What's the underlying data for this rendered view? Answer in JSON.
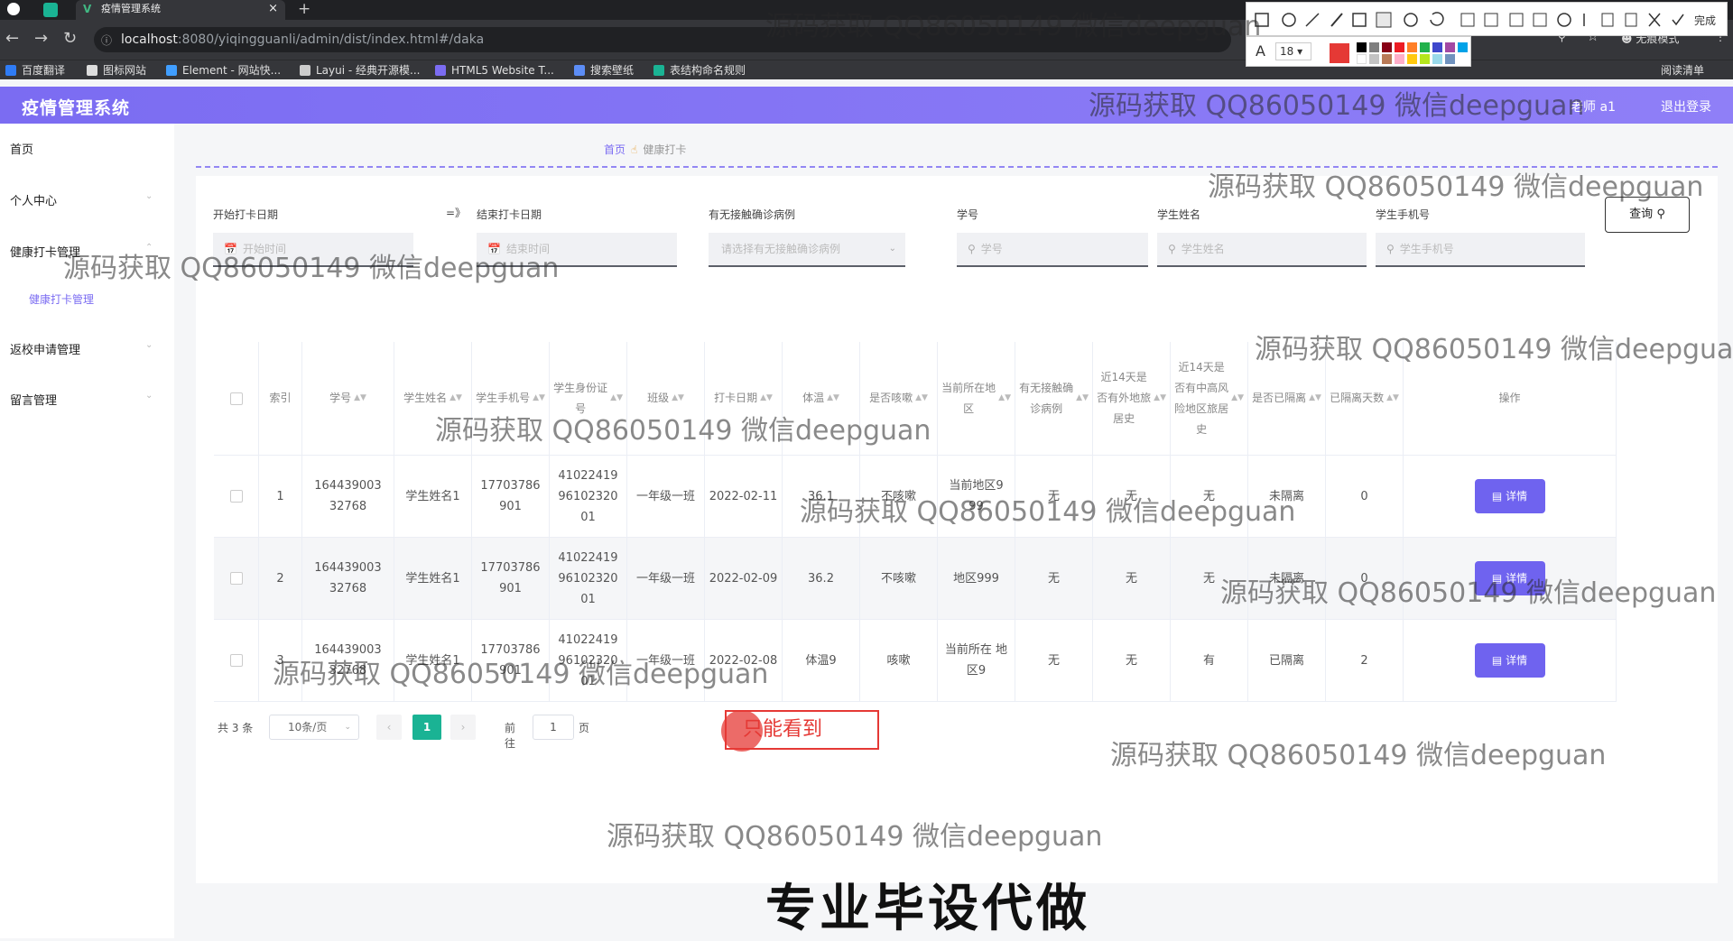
{
  "browser": {
    "tab_title": "疫情管理系统",
    "tab_close": "×",
    "new_tab": "+",
    "url_host": "localhost",
    "url_path": ":8080/yiqingguanli/admin/dist/index.html#/daka",
    "incognito": "无痕模式",
    "reading_list": "阅读清单",
    "bookmarks": [
      "百度翻译",
      "图标网站",
      "Element - 网站快...",
      "Layui - 经典开源模...",
      "HTML5 Website T...",
      "搜索壁纸",
      "表结构命名规则"
    ]
  },
  "screenshot_tool": {
    "font_size": "18",
    "done_label": "完成",
    "font_letter": "A",
    "colors": [
      "#e53935",
      "#000000",
      "#7f7f7f",
      "#880015",
      "#ed1c24",
      "#ff7f27",
      "#22b14c",
      "#3f48cc",
      "#a349a4",
      "#00a2e8",
      "#ffffff",
      "#c3c3c3",
      "#b97a57",
      "#ffaec9",
      "#ffc90e",
      "#b5e61d",
      "#99d9ea",
      "#7092be"
    ]
  },
  "header": {
    "brand": "疫情管理系统",
    "user": "老师 a1",
    "logout": "退出登录"
  },
  "sidebar": {
    "items": [
      "首页",
      "个人中心",
      "健康打卡管理",
      "返校申请管理",
      "留言管理"
    ],
    "sub_item": "健康打卡管理"
  },
  "breadcrumb": {
    "home": "首页",
    "current": "健康打卡"
  },
  "filters": {
    "start_date_label": "开始打卡日期",
    "start_date_placeholder": "开始时间",
    "range_arrow": "=》",
    "end_date_label": "结束打卡日期",
    "end_date_placeholder": "结束时间",
    "contact_label": "有无接触确诊病例",
    "contact_placeholder": "请选择有无接触确诊病例",
    "student_id_label": "学号",
    "student_id_placeholder": "学号",
    "student_name_label": "学生姓名",
    "student_name_placeholder": "学生姓名",
    "student_phone_label": "学生手机号",
    "student_phone_placeholder": "学生手机号",
    "query_button": "查询"
  },
  "table": {
    "headers": [
      "索引",
      "学号",
      "学生姓名",
      "学生手机号",
      "学生身份证号",
      "班级",
      "打卡日期",
      "体温",
      "是否咳嗽",
      "当前所在地区",
      "有无接触确诊病例",
      "近14天是否有外地旅居史",
      "近14天是否有中高风险地区旅居史",
      "是否已隔离",
      "已隔离天数",
      "操作"
    ],
    "rows": [
      [
        "1",
        "164439003 32768",
        "学生姓名1",
        "17703786 901",
        "41022419 96102320 01",
        "一年级一班",
        "2022-02-11",
        "36.1",
        "不咳嗽",
        "当前地区9 99",
        "无",
        "无",
        "无",
        "未隔离",
        "0"
      ],
      [
        "2",
        "164439003 32768",
        "学生姓名1",
        "17703786 901",
        "41022419 96102320 01",
        "一年级一班",
        "2022-02-09",
        "36.2",
        "不咳嗽",
        "地区999",
        "无",
        "无",
        "无",
        "未隔离",
        "0"
      ],
      [
        "3",
        "164439003 32768",
        "学生姓名1",
        "17703786 901",
        "41022419 96102320 01",
        "一年级一班",
        "2022-02-08",
        "体温9",
        "咳嗽",
        "当前所在 地区9",
        "无",
        "无",
        "有",
        "已隔离",
        "2"
      ]
    ],
    "detail_button": "详情"
  },
  "pagination": {
    "total": "共 3 条",
    "page_size": "10条/页",
    "current_page": "1",
    "goto_label": "前往",
    "goto_value": "1",
    "page_unit": "页"
  },
  "annotation_text": "只能看到",
  "watermark_text": "源码获取 QQ86050149 微信deepguan",
  "watermark_text_large": "源码获取 QQ86050149 微信deepguan",
  "promo_text": "专业毕设代做"
}
